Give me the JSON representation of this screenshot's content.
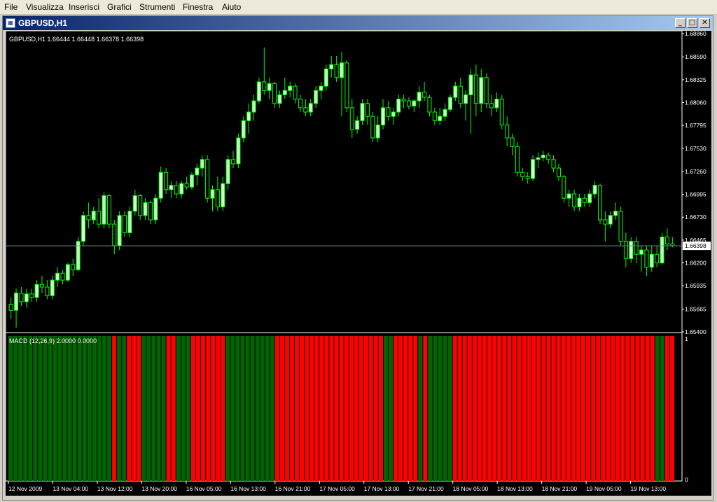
{
  "menu": {
    "items": [
      "File",
      "Visualizza",
      "Inserisci",
      "Grafici",
      "Strumenti",
      "Finestra",
      "Aiuto"
    ]
  },
  "window": {
    "title": "GBPUSD,H1",
    "buttons": [
      "minimize",
      "maximize",
      "close"
    ]
  },
  "colors": {
    "background": "#000000",
    "candle_up_fill": "#ccffcc",
    "wick": "#00ff00",
    "grid": "#ffffff",
    "bid_line": "#778899",
    "macd_up": "#006400",
    "macd_down": "#ff0000"
  },
  "chart_data": [
    {
      "type": "candlestick",
      "header": "GBPUSD,H1  1.66444 1.66448 1.66378 1.66398",
      "ylim": [
        1.654,
        1.6886
      ],
      "y_ticks": [
        "1.68860",
        "1.68590",
        "1.68325",
        "1.68060",
        "1.67795",
        "1.67530",
        "1.67260",
        "1.66995",
        "1.66730",
        "1.66465",
        "1.66200",
        "1.65935",
        "1.65665",
        "1.65400"
      ],
      "current_price": "1.66398",
      "candles": [
        [
          1.6572,
          1.658,
          1.6555,
          1.6565
        ],
        [
          1.6565,
          1.659,
          1.6545,
          1.6585
        ],
        [
          1.6585,
          1.6592,
          1.657,
          1.6575
        ],
        [
          1.6575,
          1.659,
          1.6568,
          1.6584
        ],
        [
          1.6584,
          1.659,
          1.6575,
          1.658
        ],
        [
          1.658,
          1.66,
          1.6575,
          1.6595
        ],
        [
          1.6595,
          1.6605,
          1.6585,
          1.6592
        ],
        [
          1.6592,
          1.66,
          1.6578,
          1.6582
        ],
        [
          1.6582,
          1.6605,
          1.6578,
          1.66
        ],
        [
          1.66,
          1.6615,
          1.6592,
          1.6608
        ],
        [
          1.6608,
          1.6612,
          1.6595,
          1.66
        ],
        [
          1.66,
          1.662,
          1.6598,
          1.6618
        ],
        [
          1.6618,
          1.6625,
          1.6605,
          1.6612
        ],
        [
          1.6612,
          1.665,
          1.661,
          1.6645
        ],
        [
          1.6645,
          1.668,
          1.664,
          1.6675
        ],
        [
          1.6675,
          1.669,
          1.666,
          1.667
        ],
        [
          1.667,
          1.6685,
          1.6665,
          1.668
        ],
        [
          1.668,
          1.6695,
          1.666,
          1.6665
        ],
        [
          1.6665,
          1.6702,
          1.666,
          1.6698
        ],
        [
          1.6698,
          1.67,
          1.666,
          1.6665
        ],
        [
          1.6665,
          1.667,
          1.663,
          1.664
        ],
        [
          1.664,
          1.668,
          1.6635,
          1.6675
        ],
        [
          1.6675,
          1.668,
          1.665,
          1.6655
        ],
        [
          1.6655,
          1.6685,
          1.665,
          1.668
        ],
        [
          1.668,
          1.6705,
          1.6675,
          1.6698
        ],
        [
          1.6698,
          1.67,
          1.667,
          1.6675
        ],
        [
          1.6675,
          1.6695,
          1.667,
          1.669
        ],
        [
          1.669,
          1.6692,
          1.6665,
          1.667
        ],
        [
          1.667,
          1.67,
          1.6665,
          1.6695
        ],
        [
          1.6695,
          1.6732,
          1.669,
          1.6725
        ],
        [
          1.6725,
          1.673,
          1.67,
          1.6705
        ],
        [
          1.6705,
          1.6715,
          1.6695,
          1.671
        ],
        [
          1.671,
          1.6715,
          1.6695,
          1.67
        ],
        [
          1.67,
          1.6715,
          1.6695,
          1.6712
        ],
        [
          1.6712,
          1.672,
          1.6705,
          1.6708
        ],
        [
          1.6708,
          1.6725,
          1.6705,
          1.6722
        ],
        [
          1.6722,
          1.6735,
          1.671,
          1.673
        ],
        [
          1.673,
          1.6745,
          1.672,
          1.674
        ],
        [
          1.674,
          1.6745,
          1.669,
          1.6695
        ],
        [
          1.6695,
          1.671,
          1.668,
          1.6705
        ],
        [
          1.6705,
          1.672,
          1.668,
          1.6685
        ],
        [
          1.6685,
          1.672,
          1.668,
          1.6712
        ],
        [
          1.6712,
          1.6745,
          1.6705,
          1.674
        ],
        [
          1.674,
          1.675,
          1.673,
          1.6735
        ],
        [
          1.6735,
          1.677,
          1.673,
          1.6765
        ],
        [
          1.6765,
          1.679,
          1.676,
          1.6785
        ],
        [
          1.6785,
          1.6805,
          1.677,
          1.6795
        ],
        [
          1.6795,
          1.6815,
          1.6785,
          1.6808
        ],
        [
          1.6808,
          1.6835,
          1.6805,
          1.683
        ],
        [
          1.683,
          1.687,
          1.6815,
          1.682
        ],
        [
          1.682,
          1.6835,
          1.681,
          1.6828
        ],
        [
          1.6828,
          1.683,
          1.68,
          1.6805
        ],
        [
          1.6805,
          1.682,
          1.68,
          1.6815
        ],
        [
          1.6815,
          1.6835,
          1.681,
          1.682
        ],
        [
          1.682,
          1.683,
          1.6812,
          1.6825
        ],
        [
          1.6825,
          1.6828,
          1.6805,
          1.681
        ],
        [
          1.681,
          1.6815,
          1.6795,
          1.68
        ],
        [
          1.68,
          1.681,
          1.679,
          1.6795
        ],
        [
          1.6795,
          1.681,
          1.679,
          1.6805
        ],
        [
          1.6805,
          1.6825,
          1.68,
          1.682
        ],
        [
          1.682,
          1.683,
          1.681,
          1.6825
        ],
        [
          1.6825,
          1.685,
          1.682,
          1.6845
        ],
        [
          1.6845,
          1.686,
          1.6835,
          1.685
        ],
        [
          1.685,
          1.686,
          1.683,
          1.6835
        ],
        [
          1.6835,
          1.6865,
          1.679,
          1.6852
        ],
        [
          1.6852,
          1.6855,
          1.6795,
          1.68
        ],
        [
          1.68,
          1.681,
          1.6765,
          1.6775
        ],
        [
          1.6775,
          1.679,
          1.677,
          1.6785
        ],
        [
          1.6785,
          1.681,
          1.678,
          1.6805
        ],
        [
          1.6805,
          1.681,
          1.678,
          1.679
        ],
        [
          1.679,
          1.6795,
          1.676,
          1.6765
        ],
        [
          1.6765,
          1.679,
          1.676,
          1.678
        ],
        [
          1.678,
          1.681,
          1.6775,
          1.68
        ],
        [
          1.68,
          1.6808,
          1.6785,
          1.679
        ],
        [
          1.679,
          1.68,
          1.678,
          1.6795
        ],
        [
          1.6795,
          1.6815,
          1.679,
          1.681
        ],
        [
          1.681,
          1.6815,
          1.68,
          1.6808
        ],
        [
          1.6808,
          1.6812,
          1.6798,
          1.6802
        ],
        [
          1.6802,
          1.681,
          1.6795,
          1.6808
        ],
        [
          1.6808,
          1.6825,
          1.68,
          1.6818
        ],
        [
          1.6818,
          1.683,
          1.6808,
          1.6812
        ],
        [
          1.6812,
          1.6815,
          1.679,
          1.6795
        ],
        [
          1.6795,
          1.68,
          1.678,
          1.6785
        ],
        [
          1.6785,
          1.68,
          1.678,
          1.679
        ],
        [
          1.679,
          1.6805,
          1.6785,
          1.6798
        ],
        [
          1.6798,
          1.6815,
          1.6795,
          1.6812
        ],
        [
          1.6812,
          1.683,
          1.6808,
          1.6825
        ],
        [
          1.6825,
          1.6835,
          1.68,
          1.6805
        ],
        [
          1.6805,
          1.682,
          1.6785,
          1.6815
        ],
        [
          1.6815,
          1.6845,
          1.677,
          1.6838
        ],
        [
          1.6838,
          1.685,
          1.679,
          1.6805
        ],
        [
          1.6805,
          1.6845,
          1.6795,
          1.6835
        ],
        [
          1.6835,
          1.684,
          1.68,
          1.6805
        ],
        [
          1.6805,
          1.6815,
          1.679,
          1.68
        ],
        [
          1.68,
          1.6818,
          1.6795,
          1.681
        ],
        [
          1.681,
          1.6815,
          1.6775,
          1.678
        ],
        [
          1.678,
          1.679,
          1.6755,
          1.6765
        ],
        [
          1.6765,
          1.677,
          1.6745,
          1.6755
        ],
        [
          1.6755,
          1.676,
          1.672,
          1.6725
        ],
        [
          1.6725,
          1.673,
          1.6715,
          1.672
        ],
        [
          1.672,
          1.6725,
          1.6712,
          1.6718
        ],
        [
          1.6718,
          1.6745,
          1.6715,
          1.674
        ],
        [
          1.674,
          1.6748,
          1.673,
          1.6742
        ],
        [
          1.6742,
          1.675,
          1.6738,
          1.6745
        ],
        [
          1.6745,
          1.6748,
          1.6735,
          1.674
        ],
        [
          1.674,
          1.6745,
          1.6725,
          1.673
        ],
        [
          1.673,
          1.6735,
          1.6715,
          1.672
        ],
        [
          1.672,
          1.6722,
          1.669,
          1.6695
        ],
        [
          1.6695,
          1.6705,
          1.6685,
          1.67
        ],
        [
          1.67,
          1.6705,
          1.668,
          1.6685
        ],
        [
          1.6685,
          1.67,
          1.668,
          1.6695
        ],
        [
          1.6695,
          1.67,
          1.6685,
          1.669
        ],
        [
          1.669,
          1.6705,
          1.6685,
          1.67
        ],
        [
          1.67,
          1.6715,
          1.6695,
          1.671
        ],
        [
          1.671,
          1.6712,
          1.6665,
          1.667
        ],
        [
          1.667,
          1.668,
          1.6645,
          1.6665
        ],
        [
          1.6665,
          1.668,
          1.666,
          1.6675
        ],
        [
          1.6675,
          1.669,
          1.667,
          1.668
        ],
        [
          1.668,
          1.6685,
          1.664,
          1.6645
        ],
        [
          1.6645,
          1.6655,
          1.6615,
          1.6625
        ],
        [
          1.6625,
          1.665,
          1.662,
          1.6645
        ],
        [
          1.6645,
          1.665,
          1.662,
          1.663
        ],
        [
          1.663,
          1.664,
          1.661,
          1.6635
        ],
        [
          1.6635,
          1.664,
          1.6605,
          1.6615
        ],
        [
          1.6615,
          1.664,
          1.661,
          1.663
        ],
        [
          1.663,
          1.664,
          1.6615,
          1.662
        ],
        [
          1.662,
          1.6655,
          1.6618,
          1.665
        ],
        [
          1.665,
          1.666,
          1.6635,
          1.6642
        ],
        [
          1.6642,
          1.665,
          1.6638,
          1.664
        ]
      ],
      "x_ticks": [
        "12 Nov 2009",
        "13 Nov 04:00",
        "13 Nov 12:00",
        "13 Nov 20:00",
        "16 Nov 05:00",
        "16 Nov 13:00",
        "16 Nov 21:00",
        "17 Nov 05:00",
        "17 Nov 13:00",
        "17 Nov 21:00",
        "18 Nov 05:00",
        "18 Nov 13:00",
        "18 Nov 21:00",
        "19 Nov 05:00",
        "19 Nov 13:00"
      ]
    },
    {
      "type": "bar",
      "header": "MACD (12,26,9) 2.0000 0.0000",
      "ylim": [
        0,
        1
      ],
      "y_ticks": [
        "1",
        "0"
      ],
      "series": [
        {
          "values": [
            1,
            1,
            1,
            1,
            1,
            1,
            1,
            1,
            1,
            1,
            1,
            1,
            1,
            1,
            1,
            1,
            1,
            1,
            1,
            1,
            1,
            -1,
            1,
            1,
            -1,
            -1,
            -1,
            1,
            1,
            1,
            1,
            1,
            -1,
            -1,
            1,
            1,
            1,
            -1,
            -1,
            -1,
            -1,
            -1,
            -1,
            -1,
            1,
            1,
            1,
            1,
            1,
            1,
            1,
            1,
            1,
            1,
            -1,
            -1,
            -1,
            -1,
            -1,
            -1,
            -1,
            -1,
            -1,
            -1,
            -1,
            -1,
            -1,
            -1,
            -1,
            -1,
            -1,
            -1,
            -1,
            -1,
            -1,
            -1,
            1,
            1,
            -1,
            -1,
            -1,
            -1,
            -1,
            1,
            -1,
            1,
            1,
            1,
            1,
            1,
            -1,
            -1,
            -1,
            -1,
            -1,
            -1,
            -1,
            -1,
            -1,
            -1,
            -1,
            -1,
            -1,
            -1,
            -1,
            -1,
            -1,
            -1,
            -1,
            -1,
            -1,
            -1,
            -1,
            -1,
            -1,
            -1,
            -1,
            -1,
            -1,
            -1,
            -1,
            -1,
            -1,
            -1,
            -1,
            -1,
            -1,
            -1,
            -1,
            -1,
            -1,
            1,
            1,
            -1,
            -1
          ]
        }
      ]
    }
  ]
}
